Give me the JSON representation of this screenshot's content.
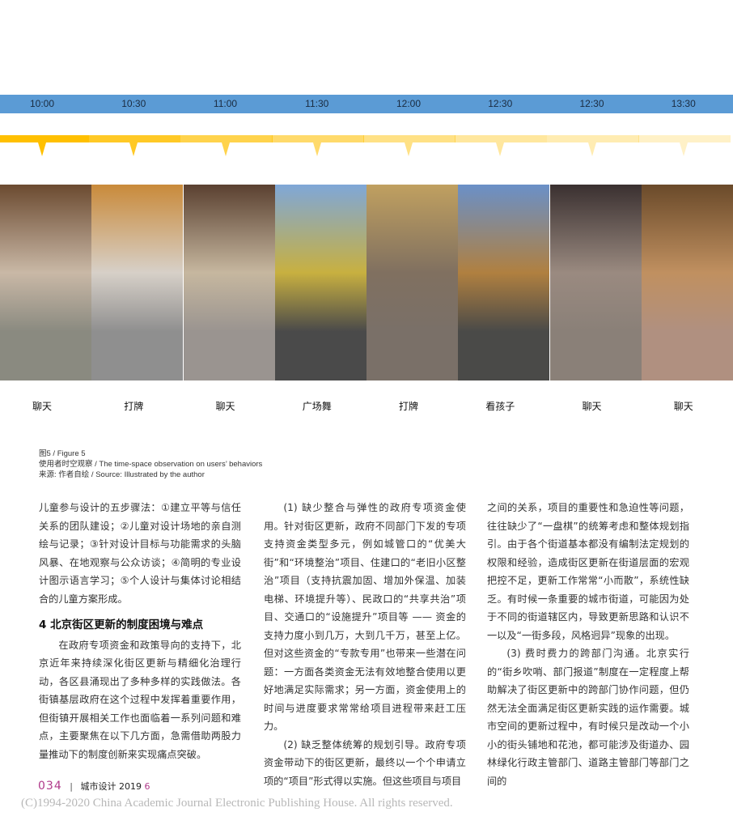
{
  "timeline": {
    "times": [
      "10:00",
      "10:30",
      "11:00",
      "11:30",
      "12:00",
      "12:30",
      "12:30",
      "13:30"
    ],
    "opacities": [
      1,
      0.85,
      0.7,
      0.58,
      0.48,
      0.38,
      0.3,
      0.22
    ],
    "accent": "#ffc000",
    "bar_color": "#5b9bd5"
  },
  "photos": [
    {
      "label": "聊天",
      "colors": [
        "#6b4a30",
        "#c9b8a6",
        "#8a8a80"
      ]
    },
    {
      "label": "打牌",
      "colors": [
        "#c98a3a",
        "#d7d0c8",
        "#8f8f8f"
      ]
    },
    {
      "label": "聊天",
      "colors": [
        "#5a4030",
        "#c6b79f",
        "#9a9490"
      ]
    },
    {
      "label": "广场舞",
      "colors": [
        "#7fa7d8",
        "#c8b040",
        "#4a4a4a"
      ]
    },
    {
      "label": "打牌",
      "colors": [
        "#c0a060",
        "#807060",
        "#7a7068"
      ]
    },
    {
      "label": "看孩子",
      "colors": [
        "#6a90c8",
        "#b08040",
        "#4a4a48"
      ]
    },
    {
      "label": "聊天",
      "colors": [
        "#3a3030",
        "#9a8a80",
        "#8a8078"
      ]
    },
    {
      "label": "聊天",
      "colors": [
        "#6a4a2a",
        "#c09060",
        "#b09080"
      ]
    }
  ],
  "caption": {
    "figure": "图5 / Figure 5",
    "title": "使用者时空观察 / The time-space observation on users’ behaviors",
    "source": "来源: 作者自绘 / Source: Illustrated by the author"
  },
  "columns": {
    "c1_p1": "儿童参与设计的五步骤法：①建立平等与信任关系的团队建设；②儿童对设计场地的亲自测绘与记录；③针对设计目标与功能需求的头脑风暴、在地观察与公众访谈；④简明的专业设计图示语言学习；⑤个人设计与集体讨论相结合的儿童方案形成。",
    "c1_heading": "4 北京街区更新的制度困境与难点",
    "c1_p2": "在政府专项资金和政策导向的支持下，北京近年来持续深化街区更新与精细化治理行动，各区县涌现出了多种多样的实践做法。各街镇基层政府在这个过程中发挥着重要作用，但街镇开展相关工作也面临着一系列问题和难点，主要聚焦在以下几方面，急需借助两股力量推动下的制度创新来实现痛点突破。",
    "c2_p1": "(1) 缺少整合与弹性的政府专项资金使用。针对街区更新，政府不同部门下发的专项支持资金类型多元，例如城管口的“优美大街”和“环境整治”项目、住建口的“老旧小区整治”项目（支持抗震加固、增加外保温、加装电梯、环境提升等）、民政口的“共享共治”项目、交通口的“设施提升”项目等 —— 资金的支持力度小到几万，大到几千万，甚至上亿。但对这些资金的“专款专用”也带来一些潜在问题：一方面各类资金无法有效地整合使用以更好地满足实际需求；另一方面，资金使用上的时间与进度要求常常给项目进程带来赶工压力。",
    "c2_p2": "(2) 缺乏整体统筹的规划引导。政府专项资金带动下的街区更新，最终以一个个申请立项的“项目”形式得以实施。但这些项目与项目",
    "c3_p1": "之间的关系，项目的重要性和急迫性等问题，往往缺少了“一盘棋”的统筹考虑和整体规划指引。由于各个街道基本都没有编制法定规划的权限和经验，造成街区更新在街道层面的宏观把控不足，更新工作常常“小而散”，系统性缺乏。有时候一条重要的城市街道，可能因为处于不同的街道辖区内，导致更新思路和认识不一以及“一街多段，风格迥异”现象的出现。",
    "c3_p2": "(3) 费时费力的跨部门沟通。北京实行的“街乡吹哨、部门报道”制度在一定程度上帮助解决了街区更新中的跨部门协作问题，但仍然无法全面满足街区更新实践的运作需要。城市空间的更新过程中，有时候只是改动一个小小的街头铺地和花池，都可能涉及街道办、园林绿化行政主管部门、道路主管部门等部门之间的"
  },
  "footer": {
    "page_number": "034",
    "separator": "|",
    "journal": "城市设计 2019",
    "issue": "6",
    "copyright": "(C)1994-2020 China Academic Journal Electronic Publishing House. All rights reserved."
  }
}
